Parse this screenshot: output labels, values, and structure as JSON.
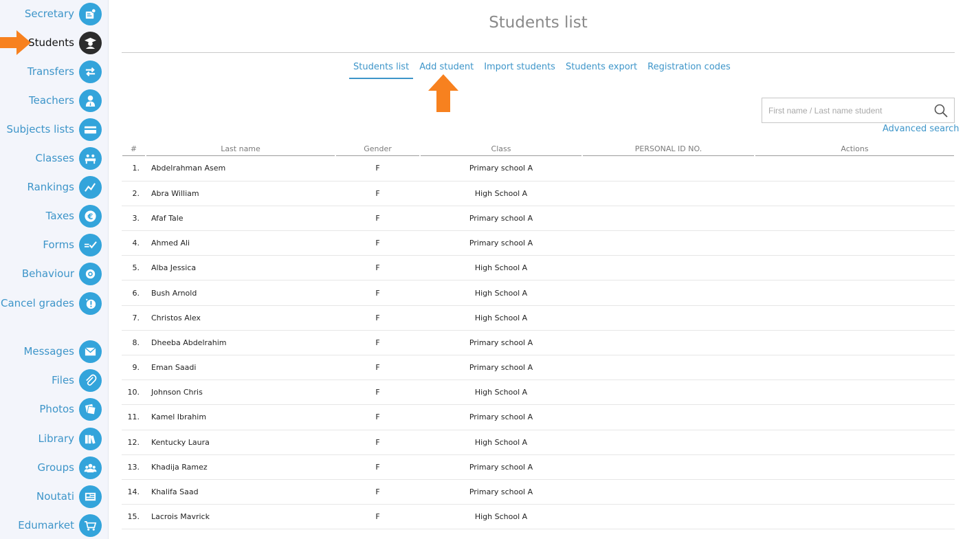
{
  "sidebar": {
    "items": [
      {
        "label": "Secretary",
        "icon": "id-badge-icon"
      },
      {
        "label": "Students",
        "icon": "graduate-icon",
        "active": true
      },
      {
        "label": "Transfers",
        "icon": "transfer-arrows-icon"
      },
      {
        "label": "Teachers",
        "icon": "teacher-icon"
      },
      {
        "label": "Subjects lists",
        "icon": "card-icon"
      },
      {
        "label": "Classes",
        "icon": "classroom-icon"
      },
      {
        "label": "Rankings",
        "icon": "trend-chart-icon"
      },
      {
        "label": "Taxes",
        "icon": "euro-icon"
      },
      {
        "label": "Forms",
        "icon": "form-check-icon"
      },
      {
        "label": "Behaviour",
        "icon": "award-icon"
      },
      {
        "label": "Cancel grades",
        "icon": "alert-icon"
      },
      {
        "label": "Messages",
        "icon": "envelope-icon"
      },
      {
        "label": "Files",
        "icon": "paperclip-icon"
      },
      {
        "label": "Photos",
        "icon": "photos-icon"
      },
      {
        "label": "Library",
        "icon": "books-icon"
      },
      {
        "label": "Groups",
        "icon": "group-icon"
      },
      {
        "label": "Noutati",
        "icon": "news-icon"
      },
      {
        "label": "Edumarket",
        "icon": "cart-icon"
      }
    ]
  },
  "page": {
    "title": "Students list"
  },
  "subnav": {
    "students_list": "Students list",
    "add_student": "Add student",
    "import_students": "Import students",
    "students_export": "Students export",
    "registration_codes": "Registration codes"
  },
  "search": {
    "placeholder": "First name / Last name student",
    "advanced": "Advanced search"
  },
  "table": {
    "headers": {
      "num": "#",
      "last_name": "Last name",
      "gender": "Gender",
      "class": "Class",
      "personal_id": "PERSONAL ID NO.",
      "actions": "Actions"
    },
    "rows": [
      {
        "num": "1.",
        "name": "Abdelrahman Asem",
        "gender": "F",
        "class": "Primary school A"
      },
      {
        "num": "2.",
        "name": "Abra William",
        "gender": "F",
        "class": "High School A"
      },
      {
        "num": "3.",
        "name": "Afaf Tale",
        "gender": "F",
        "class": "Primary school A"
      },
      {
        "num": "4.",
        "name": "Ahmed Ali",
        "gender": "F",
        "class": "Primary school A"
      },
      {
        "num": "5.",
        "name": "Alba Jessica",
        "gender": "F",
        "class": "High School A"
      },
      {
        "num": "6.",
        "name": "Bush Arnold",
        "gender": "F",
        "class": "High School A"
      },
      {
        "num": "7.",
        "name": "Christos Alex",
        "gender": "F",
        "class": "High School A"
      },
      {
        "num": "8.",
        "name": "Dheeba Abdelrahim",
        "gender": "F",
        "class": "Primary school A"
      },
      {
        "num": "9.",
        "name": "Eman Saadi",
        "gender": "F",
        "class": "Primary school A"
      },
      {
        "num": "10.",
        "name": "Johnson Chris",
        "gender": "F",
        "class": "High School A"
      },
      {
        "num": "11.",
        "name": "Kamel Ibrahim",
        "gender": "F",
        "class": "Primary school A"
      },
      {
        "num": "12.",
        "name": "Kentucky Laura",
        "gender": "F",
        "class": "High School A"
      },
      {
        "num": "13.",
        "name": "Khadija Ramez",
        "gender": "F",
        "class": "Primary school A"
      },
      {
        "num": "14.",
        "name": "Khalifa Saad",
        "gender": "F",
        "class": "Primary school A"
      },
      {
        "num": "15.",
        "name": "Lacrois Mavrick",
        "gender": "F",
        "class": "High School A"
      }
    ]
  },
  "colors": {
    "accent": "#3d95c9",
    "icon_bg": "#33a4db",
    "active_icon_bg": "#2c2c2c",
    "annotation_arrow": "#f7811f"
  }
}
